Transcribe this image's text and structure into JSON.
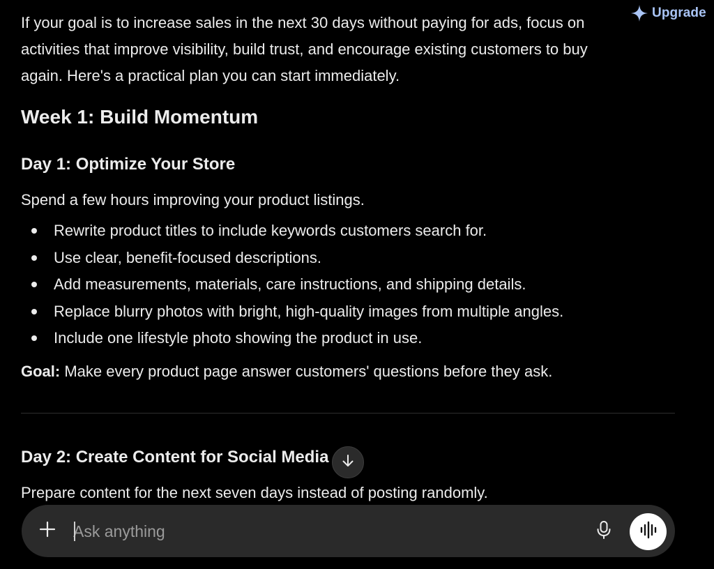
{
  "header": {
    "upgrade_label": "Upgrade",
    "upgrade_icon": "sparkle-icon",
    "accent_color": "#a9c4f5"
  },
  "message": {
    "intro": "If your goal is to increase sales in the next 30 days without paying for ads, focus on activities that improve visibility, build trust, and encourage existing customers to buy again. Here's a practical plan you can start immediately.",
    "week_heading": "Week 1: Build Momentum",
    "day1": {
      "heading": "Day 1: Optimize Your Store",
      "lead": "Spend a few hours improving your product listings.",
      "bullets": [
        "Rewrite product titles to include keywords customers search for.",
        "Use clear, benefit-focused descriptions.",
        "Add measurements, materials, care instructions, and shipping details.",
        "Replace blurry photos with bright, high-quality images from multiple angles.",
        "Include one lifestyle photo showing the product in use."
      ],
      "goal_label": "Goal:",
      "goal_text": " Make every product page answer customers' questions before they ask."
    },
    "day2": {
      "heading": "Day 2: Create Content for Social Media",
      "lead": "Prepare content for the next seven days instead of posting randomly."
    }
  },
  "scroll_button": {
    "icon": "arrow-down-icon"
  },
  "composer": {
    "placeholder": "Ask anything",
    "value": "",
    "add_icon": "plus-icon",
    "mic_icon": "microphone-icon",
    "voice_icon": "voice-waveform-icon"
  }
}
